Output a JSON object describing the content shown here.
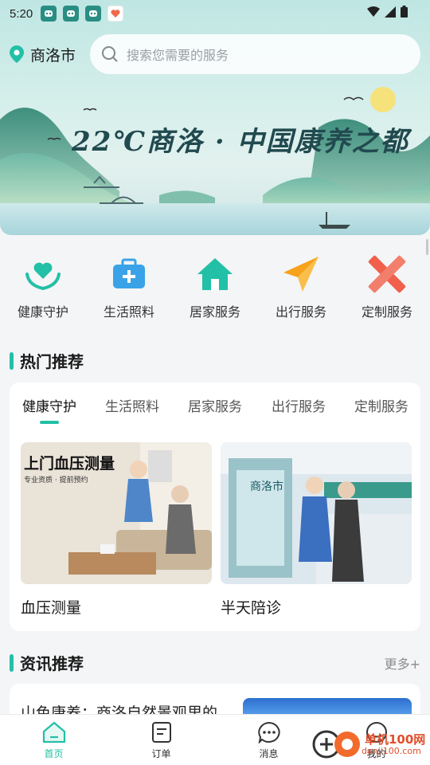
{
  "status_bar": {
    "time": "5:20"
  },
  "header": {
    "city": "商洛市",
    "search_placeholder": "搜索您需要的服务"
  },
  "banner": {
    "title": "22℃商洛 · 中国康养之都"
  },
  "services": [
    {
      "label": "健康守护",
      "icon": "heart-hands-icon",
      "color": "#22c0a6"
    },
    {
      "label": "生活照料",
      "icon": "medical-kit-icon",
      "color": "#3aa3e8"
    },
    {
      "label": "居家服务",
      "icon": "house-icon",
      "color": "#22c0a6"
    },
    {
      "label": "出行服务",
      "icon": "paper-plane-icon",
      "color": "#f7a21b"
    },
    {
      "label": "定制服务",
      "icon": "ruler-pencil-icon",
      "color": "#f0604a"
    }
  ],
  "hot": {
    "title": "热门推荐",
    "tabs": [
      "健康守护",
      "生活照料",
      "居家服务",
      "出行服务",
      "定制服务"
    ],
    "active_tab": "健康守护",
    "cards": [
      {
        "caption": "血压测量",
        "overlay_title": "上门血压测量",
        "overlay_sub": "专业资质 · 提前预约"
      },
      {
        "caption": "半天陪诊",
        "sign": "商洛市"
      }
    ]
  },
  "news": {
    "title": "资讯推荐",
    "more": "更多+",
    "first_item_title": "山色康养：商洛自然景观里的"
  },
  "bottom_nav": [
    {
      "label": "首页",
      "icon": "home-icon",
      "active": true
    },
    {
      "label": "订单",
      "icon": "order-icon",
      "active": false
    },
    {
      "label": "消息",
      "icon": "message-icon",
      "active": false
    },
    {
      "label": "我的",
      "icon": "profile-icon",
      "active": false
    }
  ],
  "watermark": {
    "line1": "单机100网",
    "line2": "danji100.com"
  },
  "colors": {
    "accent": "#22c0a6"
  }
}
